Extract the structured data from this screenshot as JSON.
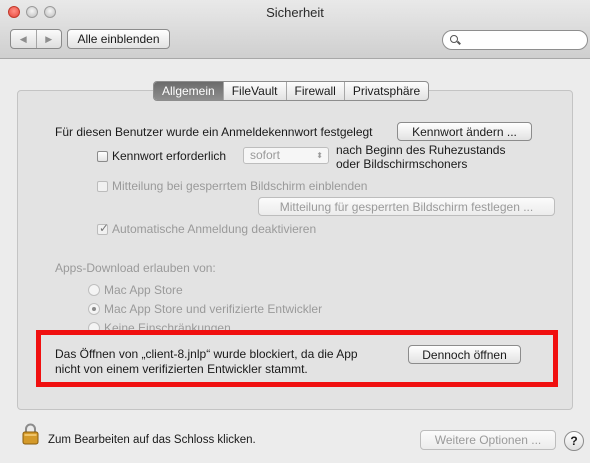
{
  "window": {
    "title": "Sicherheit"
  },
  "toolbar": {
    "back_glyph": "◀",
    "forward_glyph": "▶",
    "show_all_label": "Alle einblenden",
    "search_placeholder": ""
  },
  "tabs": [
    {
      "label": "Allgemein",
      "active": true
    },
    {
      "label": "FileVault",
      "active": false
    },
    {
      "label": "Firewall",
      "active": false
    },
    {
      "label": "Privatsphäre",
      "active": false
    }
  ],
  "general": {
    "password_set_text": "Für diesen Benutzer wurde ein Anmeldekennwort festgelegt",
    "change_password_button": "Kennwort ändern ...",
    "require_password_label": "Kennwort erforderlich",
    "require_password_checked": false,
    "require_password_delay": "sofort",
    "after_sleep_line1": "nach Beginn des Ruhezustands",
    "after_sleep_line2": "oder Bildschirmschoners",
    "show_message_label": "Mitteilung bei gesperrtem Bildschirm einblenden",
    "show_message_checked": false,
    "set_message_button": "Mitteilung für gesperrten Bildschirm festlegen ...",
    "auto_login_label": "Automatische Anmeldung deaktivieren",
    "auto_login_checked": true
  },
  "downloads": {
    "heading": "Apps-Download erlauben von:",
    "options": [
      {
        "label": "Mac App Store",
        "selected": false
      },
      {
        "label": "Mac App Store und verifizierte Entwickler",
        "selected": true
      },
      {
        "label": "Keine Einschränkungen",
        "selected": false
      }
    ]
  },
  "blocked": {
    "message_line1": "Das Öffnen von „client-8.jnlp“ wurde blockiert, da die App",
    "message_line2": "nicht von einem verifizierten Entwickler stammt.",
    "open_anyway_button": "Dennoch öffnen",
    "highlight_color": "#f01010"
  },
  "footer": {
    "lock_text": "Zum Bearbeiten auf das Schloss klicken.",
    "more_options_button": "Weitere Optionen ...",
    "help_label": "?"
  },
  "icons": {
    "lock": "lock-icon",
    "help": "help-icon",
    "search": "search-icon"
  }
}
